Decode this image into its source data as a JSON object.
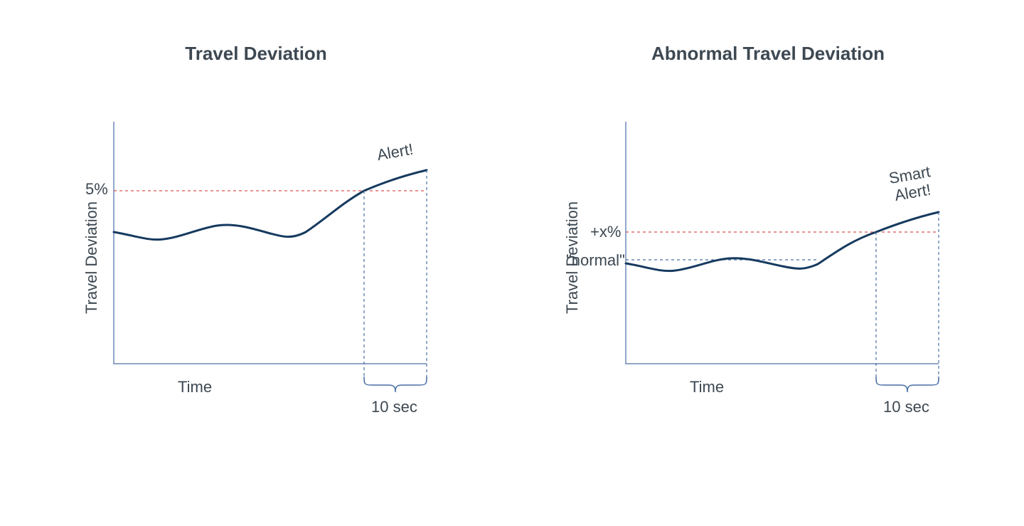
{
  "chart_data": [
    {
      "type": "line",
      "title": "Travel Deviation",
      "xlabel": "Time",
      "ylabel": "Travel Deviation",
      "threshold_label": "5%",
      "threshold_value": 5,
      "annotation": "Alert!",
      "duration_label": "10 sec",
      "series": [
        {
          "name": "deviation",
          "x": [
            0,
            1,
            2,
            3,
            4,
            5,
            6,
            7,
            8,
            9,
            10
          ],
          "y": [
            3.8,
            3.6,
            3.7,
            4.0,
            3.9,
            3.7,
            4.1,
            4.7,
            5.0,
            5.3,
            5.6
          ]
        }
      ],
      "xlim": [
        0,
        10
      ],
      "ylim": [
        0,
        7
      ]
    },
    {
      "type": "line",
      "title": "Abnormal Travel Deviation",
      "xlabel": "Time",
      "ylabel": "Travel Deviation",
      "threshold_label": "+x%",
      "baseline_label": "\"normal\"",
      "threshold_value": 3.8,
      "baseline_value": 3.0,
      "annotation_line1": "Smart",
      "annotation_line2": "Alert!",
      "duration_label": "10 sec",
      "series": [
        {
          "name": "deviation",
          "x": [
            0,
            1,
            2,
            3,
            4,
            5,
            6,
            7,
            8,
            9,
            10
          ],
          "y": [
            2.9,
            2.7,
            2.8,
            3.0,
            2.9,
            2.8,
            3.1,
            3.6,
            3.8,
            4.1,
            4.4
          ]
        }
      ],
      "xlim": [
        0,
        10
      ],
      "ylim": [
        0,
        7
      ]
    }
  ]
}
